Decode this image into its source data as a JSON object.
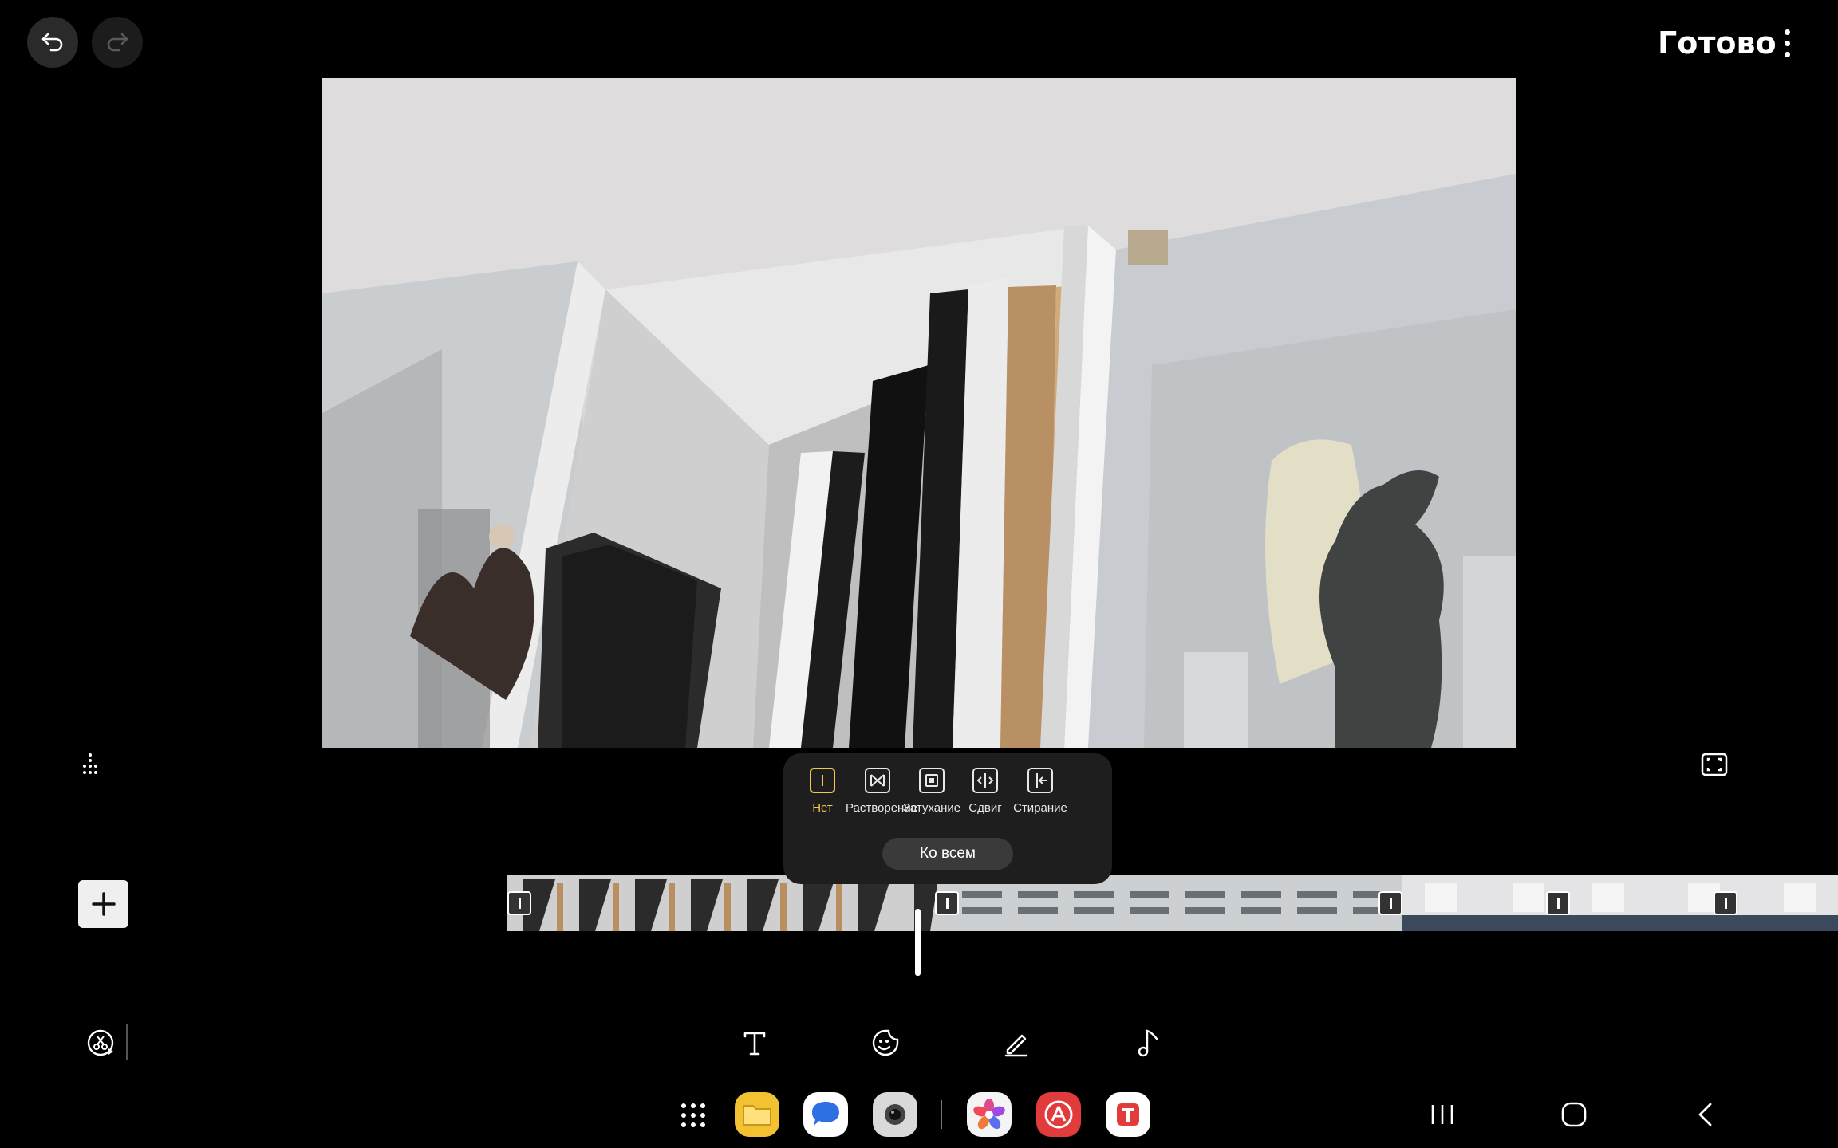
{
  "header": {
    "done_label": "Готово"
  },
  "transitions": {
    "items": [
      {
        "label": "Нет",
        "active": true
      },
      {
        "label": "Растворение",
        "active": false
      },
      {
        "label": "Затухание",
        "active": false
      },
      {
        "label": "Сдвиг",
        "active": false
      },
      {
        "label": "Стирание",
        "active": false
      }
    ],
    "apply_all_label": "Ко всем"
  },
  "dock": {
    "apps": [
      {
        "name": "Files",
        "color": "#f2c230"
      },
      {
        "name": "Messages",
        "color": "#2f6fe4"
      },
      {
        "name": "Camera",
        "color": "#9c9c9c"
      },
      {
        "name": "Gallery",
        "color": "#e04a8a"
      },
      {
        "name": "App Store",
        "color": "#e23b3b"
      },
      {
        "name": "Tinkoff",
        "color": "#ffffff"
      }
    ]
  },
  "colors": {
    "accent": "#f2c94c",
    "background": "#000000",
    "popup": "#1e1e1e"
  }
}
